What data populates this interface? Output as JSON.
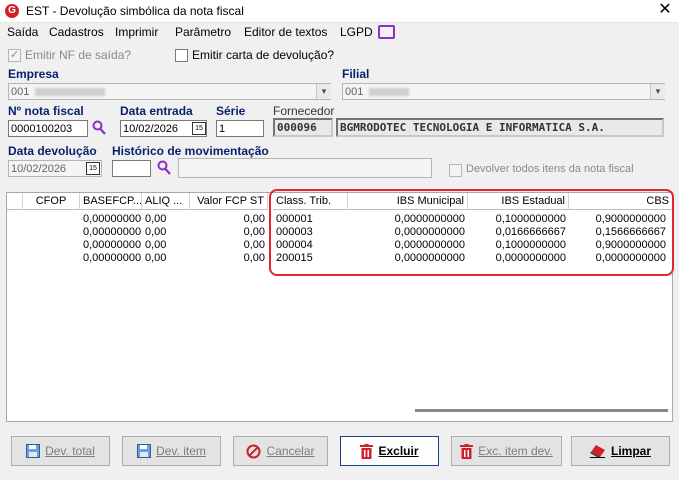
{
  "window": {
    "title": "EST - Devolução simbólica da nota fiscal",
    "close": "✕"
  },
  "menu": [
    "Saída",
    "Cadastros",
    "Imprimir",
    "Parâmetro",
    "Editor de textos",
    "LGPD"
  ],
  "options": {
    "emitir_nf": "Emitir NF de saída?",
    "emitir_carta": "Emitir carta de devolução?"
  },
  "empresa": {
    "label": "Empresa",
    "value": "001"
  },
  "filial": {
    "label": "Filial",
    "value": "001"
  },
  "nota": {
    "label": "Nº nota fiscal",
    "value": "0000100203"
  },
  "data_entrada": {
    "label": "Data entrada",
    "value": "10/02/2026"
  },
  "serie": {
    "label": "Série",
    "value": "1"
  },
  "fornecedor": {
    "label": "Fornecedor",
    "code": "000096",
    "name": "BGMRODOTEC TECNOLOGIA E INFORMATICA S.A."
  },
  "data_devolucao": {
    "label": "Data devolução",
    "value": "10/02/2026"
  },
  "historico": {
    "label": "Histórico de movimentação",
    "code": "",
    "desc": ""
  },
  "devolver_todos": "Devolver todos itens da nota fiscal",
  "calendar_glyph": "15",
  "grid": {
    "headers": [
      "",
      "CFOP",
      "BASEFCP...",
      "ALIQ ...",
      "Valor FCP ST",
      "Class. Trib.",
      "IBS Municipal",
      "IBS Estadual",
      "CBS"
    ],
    "rows": [
      [
        "",
        "",
        "0,00000000",
        "0,00",
        "0,00",
        "000001",
        "0,0000000000",
        "0,1000000000",
        "0,9000000000"
      ],
      [
        "",
        "",
        "0,00000000",
        "0,00",
        "0,00",
        "000003",
        "0,0000000000",
        "0,0166666667",
        "0,1566666667"
      ],
      [
        "",
        "",
        "0,00000000",
        "0,00",
        "0,00",
        "000004",
        "0,0000000000",
        "0,1000000000",
        "0,9000000000"
      ],
      [
        "",
        "",
        "0,00000000",
        "0,00",
        "0,00",
        "200015",
        "0,0000000000",
        "0,0000000000",
        "0,0000000000"
      ]
    ]
  },
  "buttons": {
    "dev_total": "Dev. total",
    "dev_item": "Dev. item",
    "cancelar": "Cancelar",
    "excluir": "Excluir",
    "exc_item": "Exc. item dev.",
    "limpar": "Limpar"
  },
  "colors": {
    "highlight": "#e0282e",
    "label_blue": "#0a1f6e",
    "lgpd": "#8b2fc9"
  }
}
